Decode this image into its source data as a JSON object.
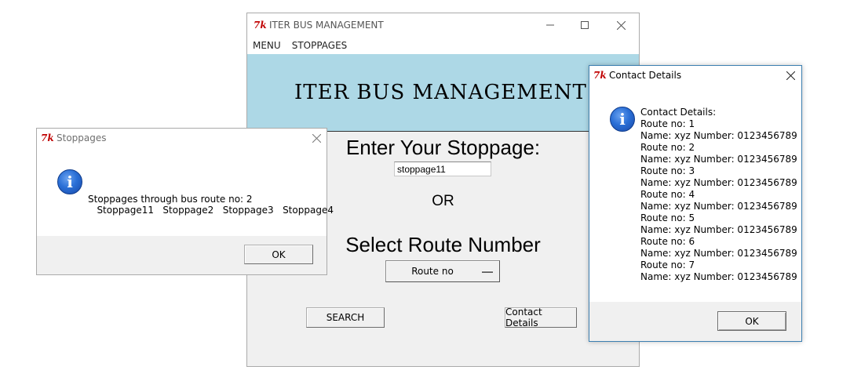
{
  "main_window": {
    "title": "ITER BUS MANAGEMENT",
    "menu": [
      "MENU",
      "STOPPAGES"
    ],
    "banner_title": "ITER BUS MANAGEMENT",
    "enter_label": "Enter Your Stoppage:",
    "stoppage_value": "stoppage11",
    "or_label": "OR",
    "select_label": "Select Route Number",
    "route_menu_value": "Route no",
    "search_label": "SEARCH",
    "contact_button_label": "Contact Details",
    "banner_color": "#add8e6"
  },
  "stoppages_dialog": {
    "title": "Stoppages",
    "message_line1": "Stoppages through bus route no: 2",
    "message_line2": "   Stoppage11   Stoppage2   Stoppage3   Stoppage4",
    "ok_label": "OK",
    "icon": "info-icon"
  },
  "contact_dialog": {
    "title": "Contact Details",
    "message": "Contact Details:\nRoute no: 1\nName: xyz Number: 0123456789\nRoute no: 2\nName: xyz Number: 0123456789\nRoute no: 3\nName: xyz Number: 0123456789\nRoute no: 4\nName: xyz Number: 0123456789\nRoute no: 5\nName: xyz Number: 0123456789\nRoute no: 6\nName: xyz Number: 0123456789\nRoute no: 7\nName: xyz Number: 0123456789",
    "ok_label": "OK",
    "icon": "info-icon",
    "accent_border": "#3c7fb1"
  },
  "icons": {
    "app_logo": "tk-logo",
    "info_glyph": "i"
  }
}
